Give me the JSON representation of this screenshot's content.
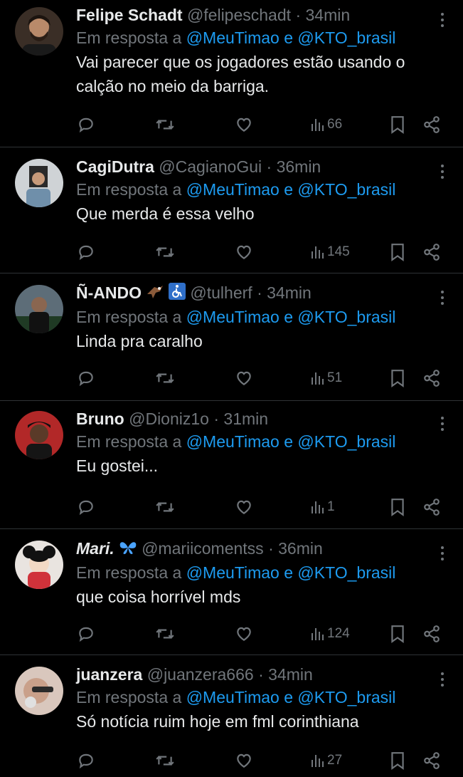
{
  "tweets": [
    {
      "name": "Felipe Schadt",
      "handle": "@felipeschadt",
      "dot": "·",
      "time": "34min",
      "reply_prefix": "Em resposta a",
      "reply_to": "@MeuTimao e @KTO_brasil",
      "text_lines": [
        "Vai parecer que os jogadores estão usando o",
        "calção no meio da barriga."
      ],
      "views": "66"
    },
    {
      "name": "CagiDutra",
      "handle": "@CagianoGui",
      "dot": "·",
      "time": "36min",
      "reply_prefix": "Em resposta a",
      "reply_to": "@MeuTimao e @KTO_brasil",
      "text_lines": [
        "Que merda é essa velho"
      ],
      "views": "145"
    },
    {
      "name": "Ñ-ANDO",
      "handle": "@tulherf",
      "dot": "·",
      "time": "34min",
      "reply_prefix": "Em resposta a",
      "reply_to": "@MeuTimao e @KTO_brasil",
      "text_lines": [
        "Linda pra caralho"
      ],
      "views": "51",
      "emojis": [
        "eagle-emoji",
        "wheelchair-emoji"
      ]
    },
    {
      "name": "Bruno",
      "handle": "@Dioniz1o",
      "dot": "·",
      "time": "31min",
      "reply_prefix": "Em resposta a",
      "reply_to": "@MeuTimao e @KTO_brasil",
      "text_lines": [
        "Eu gostei..."
      ],
      "views": "1"
    },
    {
      "name": "Mari.",
      "handle": "@mariicomentss",
      "dot": "·",
      "time": "36min",
      "reply_prefix": "Em resposta a",
      "reply_to": "@MeuTimao e @KTO_brasil",
      "text_lines": [
        "que coisa horrível mds"
      ],
      "views": "124",
      "emojis": [
        "butterfly-emoji"
      ]
    },
    {
      "name": "juanzera",
      "handle": "@juanzera666",
      "dot": "·",
      "time": "34min",
      "reply_prefix": "Em resposta a",
      "reply_to": "@MeuTimao e @KTO_brasil",
      "text_lines": [
        "Só notícia ruim hoje em fml corinthiana"
      ],
      "views": "27"
    }
  ],
  "colors": {
    "background": "#000000",
    "text": "#e7e9ea",
    "muted": "#71767b",
    "link": "#1d9bf0",
    "divider": "#2f3336"
  },
  "icons": [
    "reply-icon",
    "retweet-icon",
    "like-icon",
    "views-icon",
    "bookmark-icon",
    "share-icon",
    "more-icon"
  ]
}
